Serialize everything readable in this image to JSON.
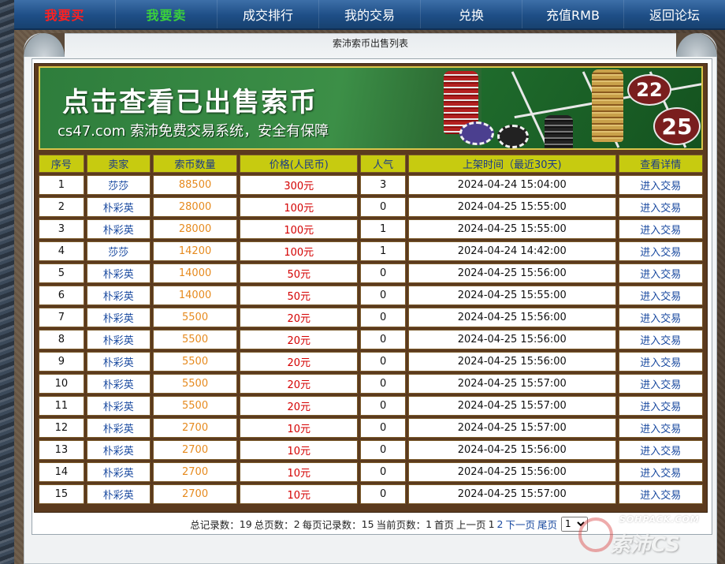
{
  "nav": {
    "buy": "我要买",
    "sell": "我要卖",
    "ranking": "成交排行",
    "my_trades": "我的交易",
    "exchange": "兑换",
    "recharge": "充值RMB",
    "back_forum": "返回论坛"
  },
  "panel": {
    "title": "索沛索币出售列表"
  },
  "banner": {
    "headline": "点击查看已出售索币",
    "tagline": "cs47.com 索沛免费交易系统，安全有保障",
    "felt_numbers": [
      "22",
      "25"
    ]
  },
  "table": {
    "headers": [
      "序号",
      "卖家",
      "索币数量",
      "价格(人民币)",
      "人气",
      "上架时间（最近30天)",
      "查看详情"
    ],
    "rows": [
      {
        "idx": "1",
        "seller": "莎莎",
        "amount": "88500",
        "price": "300元",
        "popularity": "3",
        "time": "2024-04-24 15:04:00",
        "link": "进入交易"
      },
      {
        "idx": "2",
        "seller": "朴彩英",
        "amount": "28000",
        "price": "100元",
        "popularity": "0",
        "time": "2024-04-25 15:55:00",
        "link": "进入交易"
      },
      {
        "idx": "3",
        "seller": "朴彩英",
        "amount": "28000",
        "price": "100元",
        "popularity": "1",
        "time": "2024-04-25 15:55:00",
        "link": "进入交易"
      },
      {
        "idx": "4",
        "seller": "莎莎",
        "amount": "14200",
        "price": "100元",
        "popularity": "1",
        "time": "2024-04-24 14:42:00",
        "link": "进入交易"
      },
      {
        "idx": "5",
        "seller": "朴彩英",
        "amount": "14000",
        "price": "50元",
        "popularity": "0",
        "time": "2024-04-25 15:56:00",
        "link": "进入交易"
      },
      {
        "idx": "6",
        "seller": "朴彩英",
        "amount": "14000",
        "price": "50元",
        "popularity": "0",
        "time": "2024-04-25 15:55:00",
        "link": "进入交易"
      },
      {
        "idx": "7",
        "seller": "朴彩英",
        "amount": "5500",
        "price": "20元",
        "popularity": "0",
        "time": "2024-04-25 15:56:00",
        "link": "进入交易"
      },
      {
        "idx": "8",
        "seller": "朴彩英",
        "amount": "5500",
        "price": "20元",
        "popularity": "0",
        "time": "2024-04-25 15:56:00",
        "link": "进入交易"
      },
      {
        "idx": "9",
        "seller": "朴彩英",
        "amount": "5500",
        "price": "20元",
        "popularity": "0",
        "time": "2024-04-25 15:56:00",
        "link": "进入交易"
      },
      {
        "idx": "10",
        "seller": "朴彩英",
        "amount": "5500",
        "price": "20元",
        "popularity": "0",
        "time": "2024-04-25 15:57:00",
        "link": "进入交易"
      },
      {
        "idx": "11",
        "seller": "朴彩英",
        "amount": "5500",
        "price": "20元",
        "popularity": "0",
        "time": "2024-04-25 15:57:00",
        "link": "进入交易"
      },
      {
        "idx": "12",
        "seller": "朴彩英",
        "amount": "2700",
        "price": "10元",
        "popularity": "0",
        "time": "2024-04-25 15:57:00",
        "link": "进入交易"
      },
      {
        "idx": "13",
        "seller": "朴彩英",
        "amount": "2700",
        "price": "10元",
        "popularity": "0",
        "time": "2024-04-25 15:56:00",
        "link": "进入交易"
      },
      {
        "idx": "14",
        "seller": "朴彩英",
        "amount": "2700",
        "price": "10元",
        "popularity": "0",
        "time": "2024-04-25 15:56:00",
        "link": "进入交易"
      },
      {
        "idx": "15",
        "seller": "朴彩英",
        "amount": "2700",
        "price": "10元",
        "popularity": "0",
        "time": "2024-04-25 15:57:00",
        "link": "进入交易"
      }
    ]
  },
  "pager": {
    "total_records_label": "总记录数：",
    "total_records": "19",
    "total_pages_label": "总页数：",
    "total_pages": "2",
    "per_page_label": "每页记录数：",
    "per_page": "15",
    "current_page_label": "当前页数：",
    "current_page": "1",
    "first": "首页",
    "prev": "上一页",
    "page_1": "1",
    "page_2": "2",
    "next": "下一页",
    "last": "尾页",
    "select_value": "1"
  },
  "watermark": {
    "top": "SOHPACK.COM",
    "main": "索沛CS"
  }
}
